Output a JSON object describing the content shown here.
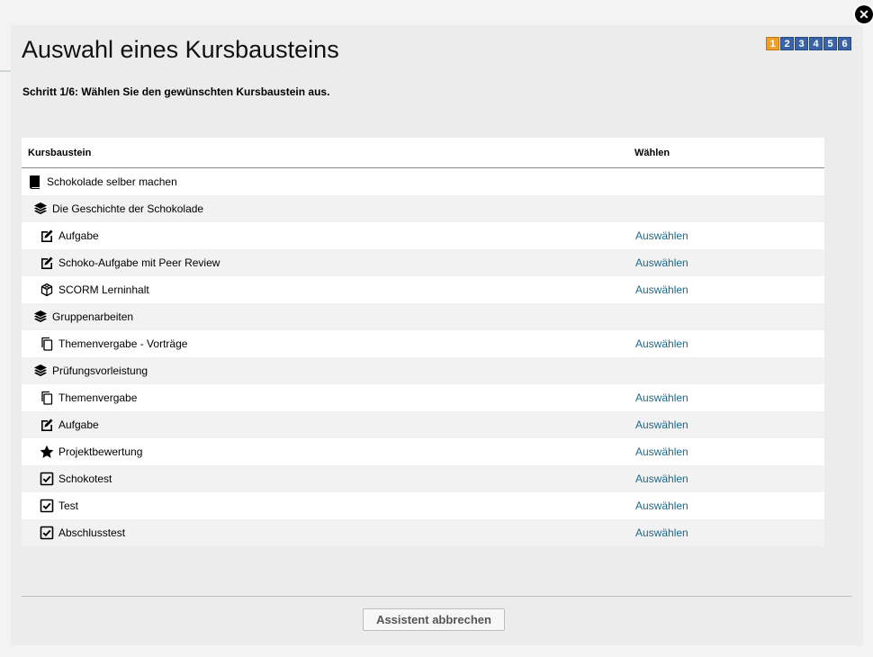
{
  "dialog": {
    "title": "Auswahl eines Kursbausteins",
    "step_text": "Schritt 1/6: Wählen Sie den gewünschten Kursbaustein aus.",
    "steps": [
      "1",
      "2",
      "3",
      "4",
      "5",
      "6"
    ],
    "active_step": "1",
    "cancel_label": "Assistent abbrechen",
    "close_icon": "close-icon"
  },
  "table": {
    "headers": {
      "course": "Kursbaustein",
      "select": "Wählen"
    },
    "rows": [
      {
        "label": "Schokolade selber machen",
        "icon": "book-icon",
        "level": 0,
        "action": ""
      },
      {
        "label": "Die Geschichte der Schokolade",
        "icon": "layers-icon",
        "level": 1,
        "action": ""
      },
      {
        "label": "Aufgabe",
        "icon": "edit-icon",
        "level": 2,
        "action": "Auswählen"
      },
      {
        "label": "Schoko-Aufgabe mit Peer Review",
        "icon": "edit-icon",
        "level": 2,
        "action": "Auswählen"
      },
      {
        "label": "SCORM Lerninhalt",
        "icon": "cube-icon",
        "level": 2,
        "action": "Auswählen"
      },
      {
        "label": "Gruppenarbeiten",
        "icon": "layers-icon",
        "level": 1,
        "action": ""
      },
      {
        "label": "Themenvergabe - Vorträge",
        "icon": "copy-icon",
        "level": 2,
        "action": "Auswählen"
      },
      {
        "label": "Prüfungsvorleistung",
        "icon": "layers-icon",
        "level": 1,
        "action": ""
      },
      {
        "label": "Themenvergabe",
        "icon": "copy-icon",
        "level": 2,
        "action": "Auswählen"
      },
      {
        "label": "Aufgabe",
        "icon": "edit-icon",
        "level": 2,
        "action": "Auswählen"
      },
      {
        "label": "Projektbewertung",
        "icon": "star-icon",
        "level": 2,
        "action": "Auswählen"
      },
      {
        "label": "Schokotest",
        "icon": "checkbox-icon",
        "level": 2,
        "action": "Auswählen"
      },
      {
        "label": "Test",
        "icon": "checkbox-icon",
        "level": 2,
        "action": "Auswählen"
      },
      {
        "label": "Abschlusstest",
        "icon": "checkbox-icon",
        "level": 2,
        "action": "Auswählen"
      }
    ]
  },
  "colors": {
    "active_step": "#f0a028",
    "inactive_step": "#3a64a8",
    "link": "#1a6a8a"
  }
}
